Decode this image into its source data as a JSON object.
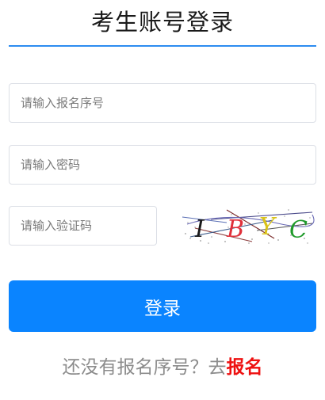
{
  "header": {
    "title": "考生账号登录"
  },
  "form": {
    "registration_number": {
      "placeholder": "请输入报名序号",
      "value": ""
    },
    "password": {
      "placeholder": "请输入密码",
      "value": ""
    },
    "captcha_input": {
      "placeholder": "请输入验证码",
      "value": ""
    },
    "captcha_image": {
      "chars": [
        "I",
        "B",
        "Y",
        "C"
      ],
      "char_colors": [
        "#1a1a1a",
        "#e0303a",
        "#d9c21a",
        "#1f9a2a"
      ]
    },
    "login_button_label": "登录"
  },
  "footer": {
    "prompt": "还没有报名序号？去",
    "register_link": "报名"
  },
  "colors": {
    "accent": "#0a84ff",
    "title_underline": "#2d8cf0",
    "register_link": "#ee1111"
  }
}
